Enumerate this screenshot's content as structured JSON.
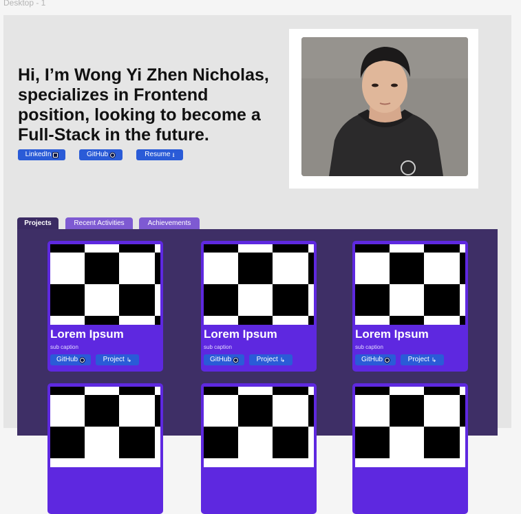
{
  "frame": {
    "label": "Desktop - 1"
  },
  "hero": {
    "title": "Hi, I’m Wong Yi Zhen Nicholas, specializes in Frontend position, looking to become a Full-Stack in the future.",
    "buttons": [
      {
        "label": "LinkedIn",
        "icon": "linkedin-icon"
      },
      {
        "label": "GitHub",
        "icon": "github-icon"
      },
      {
        "label": "Resume",
        "icon": "download-icon"
      }
    ]
  },
  "tabs": [
    {
      "label": "Projects",
      "active": true
    },
    {
      "label": "Recent Activities",
      "active": false
    },
    {
      "label": "Achievements",
      "active": false
    }
  ],
  "cards": [
    {
      "title": "Lorem Ipsum",
      "subtitle": "sub caption",
      "github_label": "GitHub",
      "project_label": "Project"
    },
    {
      "title": "Lorem Ipsum",
      "subtitle": "sub caption",
      "github_label": "GitHub",
      "project_label": "Project"
    },
    {
      "title": "Lorem Ipsum",
      "subtitle": "sub caption",
      "github_label": "GitHub",
      "project_label": "Project"
    },
    {
      "title": "",
      "subtitle": "",
      "github_label": "",
      "project_label": ""
    },
    {
      "title": "",
      "subtitle": "",
      "github_label": "",
      "project_label": ""
    },
    {
      "title": "",
      "subtitle": "",
      "github_label": "",
      "project_label": ""
    }
  ],
  "colors": {
    "accent_blue": "#2a5bd7",
    "panel_purple": "#3e2f66",
    "card_purple": "#5e28e0",
    "tab_inactive": "#7e5ad2"
  }
}
